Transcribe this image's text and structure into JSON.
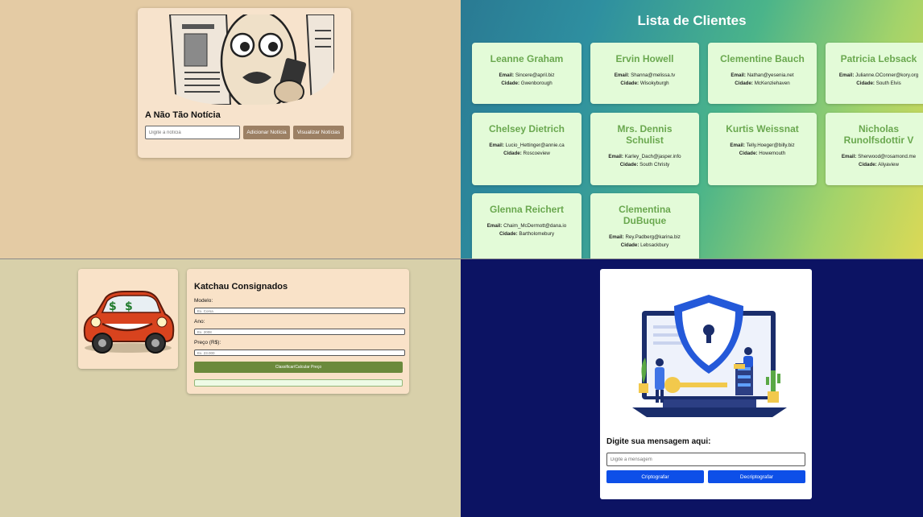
{
  "news": {
    "title": "A Não Tão Notícia",
    "input_placeholder": "Digite a notícia",
    "add_button": "Adicionar Notícia",
    "view_button": "Visualizar Notícias"
  },
  "clients": {
    "title": "Lista de Clientes",
    "email_label": "Email:",
    "city_label": "Cidade:",
    "items": [
      {
        "name": "Leanne Graham",
        "email": "Sincere@april.biz",
        "city": "Gwenborough"
      },
      {
        "name": "Ervin Howell",
        "email": "Shanna@melissa.tv",
        "city": "Wisokyburgh"
      },
      {
        "name": "Clementine Bauch",
        "email": "Nathan@yesenia.net",
        "city": "McKenziehaven"
      },
      {
        "name": "Patricia Lebsack",
        "email": "Julianne.OConner@kory.org",
        "city": "South Elvis"
      },
      {
        "name": "Chelsey Dietrich",
        "email": "Lucio_Hettinger@annie.ca",
        "city": "Roscoeview"
      },
      {
        "name": "Mrs. Dennis Schulist",
        "email": "Karley_Dach@jasper.info",
        "city": "South Christy"
      },
      {
        "name": "Kurtis Weissnat",
        "email": "Telly.Hoeger@billy.biz",
        "city": "Howemouth"
      },
      {
        "name": "Nicholas Runolfsdottir V",
        "email": "Sherwood@rosamond.me",
        "city": "Aliyaview"
      },
      {
        "name": "Glenna Reichert",
        "email": "Chaim_McDermott@dana.io",
        "city": "Bartholomebury"
      },
      {
        "name": "Clementina DuBuque",
        "email": "Rey.Padberg@karina.biz",
        "city": "Lebsackbury"
      }
    ]
  },
  "car": {
    "title": "Katchau Consignados",
    "model_label": "Modelo:",
    "model_placeholder": "Ex. Corsa",
    "year_label": "Ano:",
    "year_placeholder": "Ex. 2008",
    "price_label": "Preço (R$):",
    "price_placeholder": "Ex. 23.000",
    "button": "Classificar/Calcular Preço"
  },
  "crypto": {
    "title": "Digite sua mensagem aqui:",
    "input_placeholder": "Digite a mensagem",
    "encrypt_button": "Criptografar",
    "decrypt_button": "Decriptografar"
  }
}
